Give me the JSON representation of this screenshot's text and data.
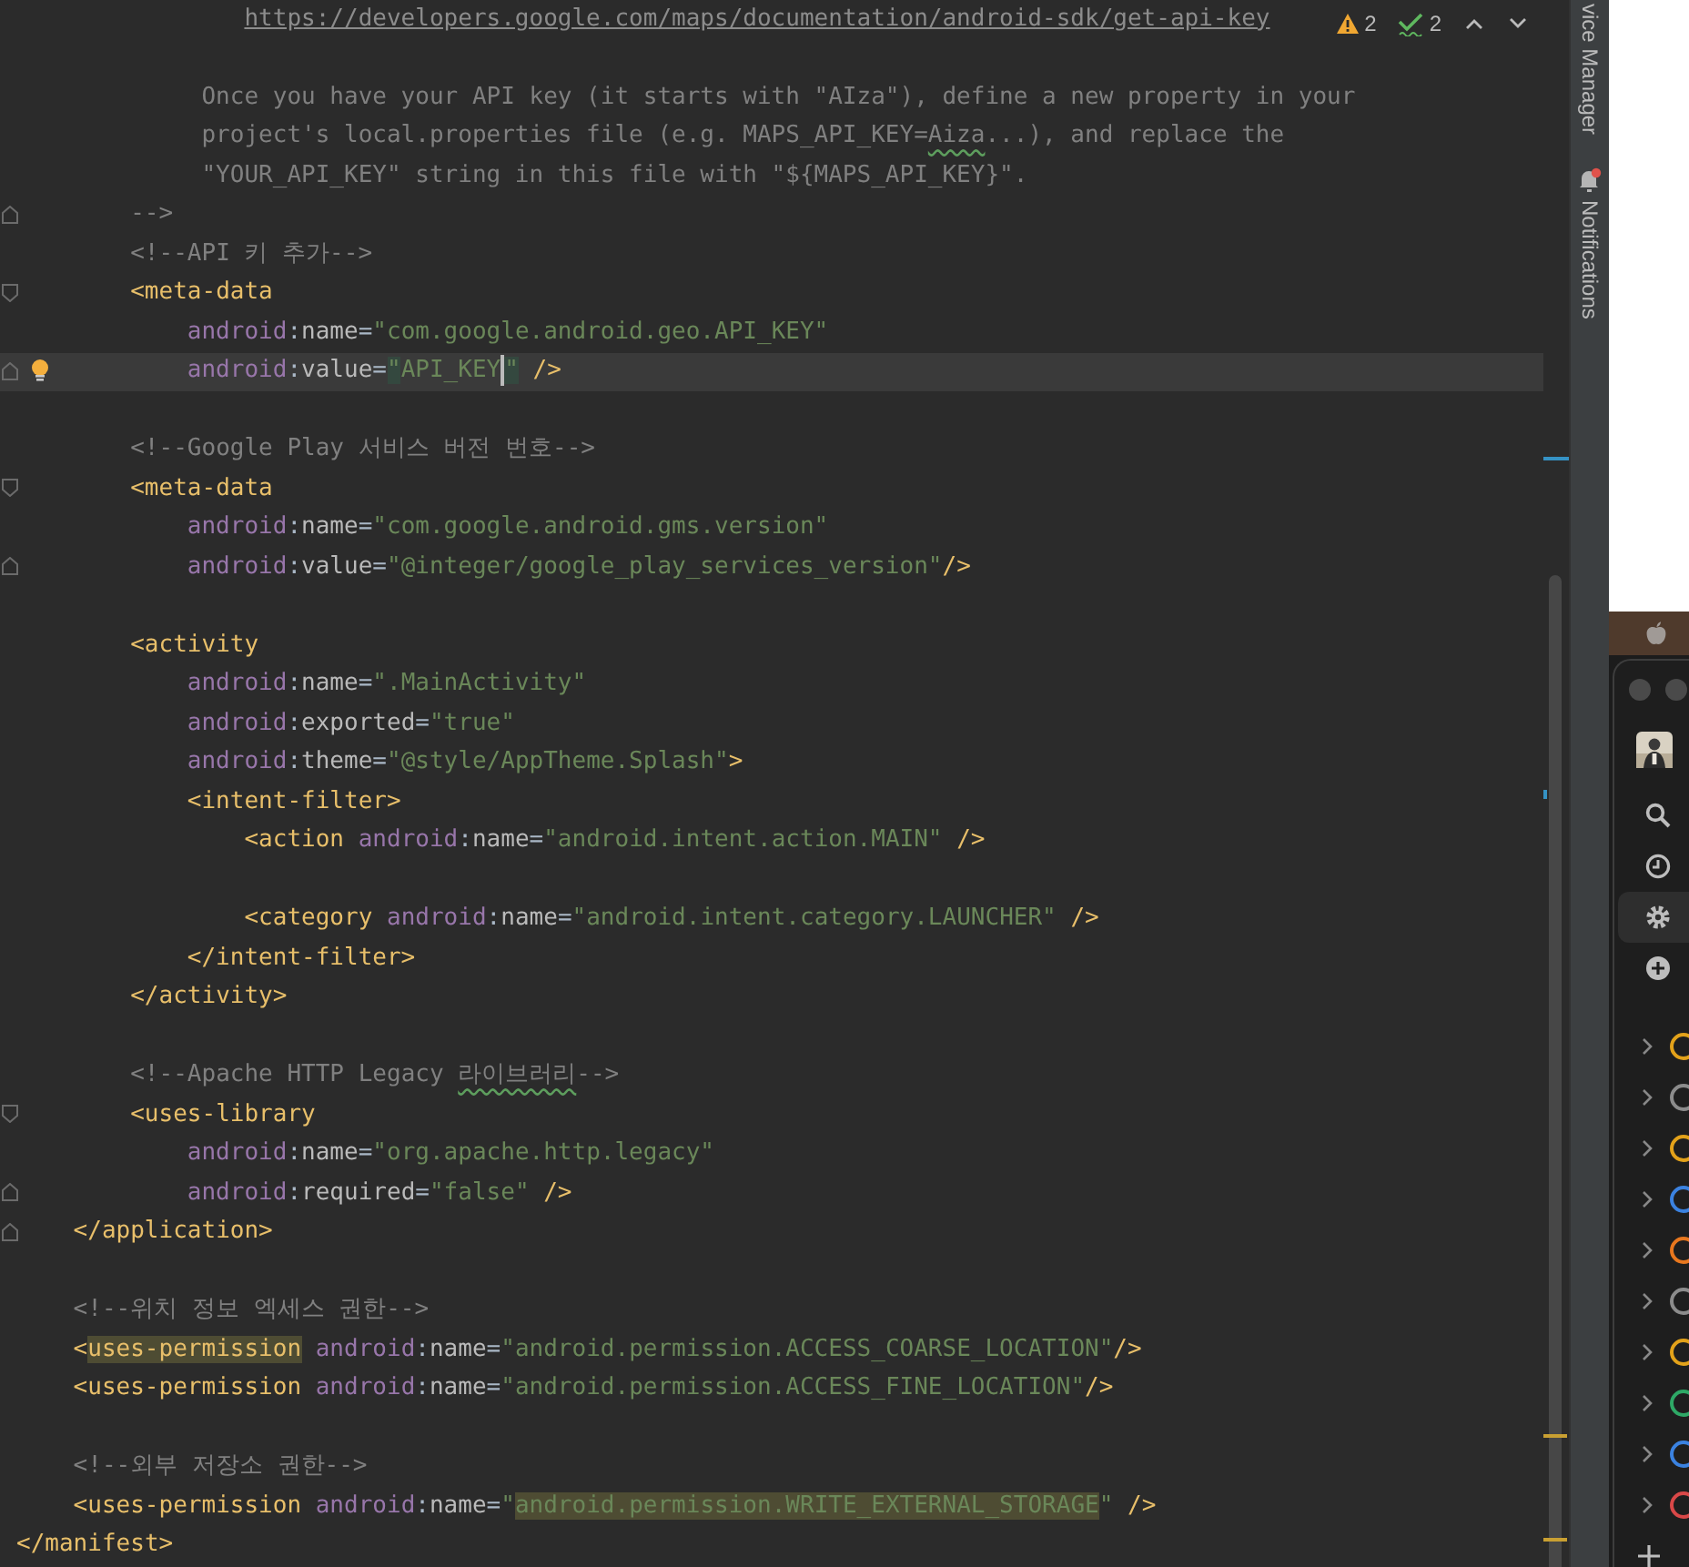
{
  "editor": {
    "lines": [
      {
        "kind": "code",
        "tokens": [
          {
            "kind": "link",
            "text": "                https://developers.google.com/maps/documentation/android-sdk/get-api-key"
          }
        ]
      },
      {
        "kind": "blank"
      },
      {
        "kind": "code",
        "tokens": [
          {
            "kind": "comment",
            "text": "             Once you have your API key (it starts with \"AIza\"), define a new property in your"
          }
        ]
      },
      {
        "kind": "code",
        "tokens": [
          {
            "kind": "comment",
            "text": "             project's local.properties file (e.g. MAPS_API_KEY="
          },
          {
            "kind": "comment",
            "text": "Aiza",
            "typo": true
          },
          {
            "kind": "comment",
            "text": "...), and replace the"
          }
        ]
      },
      {
        "kind": "code",
        "tokens": [
          {
            "kind": "comment",
            "text": "             \"YOUR_API_KEY\" string in this file with \"${MAPS_API_KEY}\"."
          }
        ]
      },
      {
        "kind": "code",
        "fold_end": true,
        "tokens": [
          {
            "kind": "comment",
            "text": "        -->"
          }
        ]
      },
      {
        "kind": "code",
        "tokens": [
          {
            "kind": "comment",
            "text": "        <!--API 키 추가-->"
          }
        ]
      },
      {
        "kind": "code",
        "fold_start": true,
        "tokens": [
          {
            "kind": "tag",
            "text": "        <meta-data"
          }
        ]
      },
      {
        "kind": "code",
        "tokens": [
          {
            "kind": "ns",
            "text": "            android"
          },
          {
            "kind": "punct",
            "text": ":"
          },
          {
            "kind": "attr",
            "text": "name"
          },
          {
            "kind": "punct",
            "text": "="
          },
          {
            "kind": "string",
            "text": "\"com.google.android.geo.API_KEY\""
          }
        ]
      },
      {
        "kind": "code",
        "fold_end": true,
        "current": true,
        "intention": true,
        "tokens": [
          {
            "kind": "ns",
            "text": "            android"
          },
          {
            "kind": "punct",
            "text": ":"
          },
          {
            "kind": "attr",
            "text": "value"
          },
          {
            "kind": "punct",
            "text": "="
          },
          {
            "kind": "string",
            "text": "\"",
            "brace_match": true
          },
          {
            "kind": "string",
            "text": "API_KEY",
            "caret": true
          },
          {
            "kind": "string",
            "text": "\"",
            "brace_match": true
          },
          {
            "kind": "tag",
            "text": " />"
          }
        ]
      },
      {
        "kind": "blank"
      },
      {
        "kind": "code",
        "tokens": [
          {
            "kind": "comment",
            "text": "        <!--Google Play 서비스 버전 번호-->"
          }
        ]
      },
      {
        "kind": "code",
        "fold_start": true,
        "tokens": [
          {
            "kind": "tag",
            "text": "        <meta-data"
          }
        ]
      },
      {
        "kind": "code",
        "tokens": [
          {
            "kind": "ns",
            "text": "            android"
          },
          {
            "kind": "punct",
            "text": ":"
          },
          {
            "kind": "attr",
            "text": "name"
          },
          {
            "kind": "punct",
            "text": "="
          },
          {
            "kind": "string",
            "text": "\"com.google.android.gms.version\""
          }
        ]
      },
      {
        "kind": "code",
        "fold_end": true,
        "tokens": [
          {
            "kind": "ns",
            "text": "            android"
          },
          {
            "kind": "punct",
            "text": ":"
          },
          {
            "kind": "attr",
            "text": "value"
          },
          {
            "kind": "punct",
            "text": "="
          },
          {
            "kind": "string",
            "text": "\"@integer/google_play_services_version\""
          },
          {
            "kind": "tag",
            "text": "/>"
          }
        ]
      },
      {
        "kind": "blank"
      },
      {
        "kind": "code",
        "tokens": [
          {
            "kind": "tag",
            "text": "        <activity"
          }
        ]
      },
      {
        "kind": "code",
        "tokens": [
          {
            "kind": "ns",
            "text": "            android"
          },
          {
            "kind": "punct",
            "text": ":"
          },
          {
            "kind": "attr",
            "text": "name"
          },
          {
            "kind": "punct",
            "text": "="
          },
          {
            "kind": "string",
            "text": "\".MainActivity\""
          }
        ]
      },
      {
        "kind": "code",
        "tokens": [
          {
            "kind": "ns",
            "text": "            android"
          },
          {
            "kind": "punct",
            "text": ":"
          },
          {
            "kind": "attr",
            "text": "exported"
          },
          {
            "kind": "punct",
            "text": "="
          },
          {
            "kind": "string",
            "text": "\"true\""
          }
        ]
      },
      {
        "kind": "code",
        "tokens": [
          {
            "kind": "ns",
            "text": "            android"
          },
          {
            "kind": "punct",
            "text": ":"
          },
          {
            "kind": "attr",
            "text": "theme"
          },
          {
            "kind": "punct",
            "text": "="
          },
          {
            "kind": "string",
            "text": "\"@style/AppTheme.Splash\""
          },
          {
            "kind": "tag",
            "text": ">"
          }
        ]
      },
      {
        "kind": "code",
        "tokens": [
          {
            "kind": "tag",
            "text": "            <intent-filter>"
          }
        ]
      },
      {
        "kind": "code",
        "tokens": [
          {
            "kind": "tag",
            "text": "                <action"
          },
          {
            "kind": "ns",
            "text": " android"
          },
          {
            "kind": "punct",
            "text": ":"
          },
          {
            "kind": "attr",
            "text": "name"
          },
          {
            "kind": "punct",
            "text": "="
          },
          {
            "kind": "string",
            "text": "\"android.intent.action.MAIN\""
          },
          {
            "kind": "tag",
            "text": " />"
          }
        ]
      },
      {
        "kind": "blank"
      },
      {
        "kind": "code",
        "tokens": [
          {
            "kind": "tag",
            "text": "                <category"
          },
          {
            "kind": "ns",
            "text": " android"
          },
          {
            "kind": "punct",
            "text": ":"
          },
          {
            "kind": "attr",
            "text": "name"
          },
          {
            "kind": "punct",
            "text": "="
          },
          {
            "kind": "string",
            "text": "\"android.intent.category.LAUNCHER\""
          },
          {
            "kind": "tag",
            "text": " />"
          }
        ]
      },
      {
        "kind": "code",
        "tokens": [
          {
            "kind": "tag",
            "text": "            </intent-filter>"
          }
        ]
      },
      {
        "kind": "code",
        "tokens": [
          {
            "kind": "tag",
            "text": "        </activity>"
          }
        ]
      },
      {
        "kind": "blank"
      },
      {
        "kind": "code",
        "tokens": [
          {
            "kind": "comment",
            "text": "        <!--Apache HTTP Legacy "
          },
          {
            "kind": "comment",
            "text": "라이브러리",
            "typo": true
          },
          {
            "kind": "comment",
            "text": "-->"
          }
        ]
      },
      {
        "kind": "code",
        "fold_start": true,
        "tokens": [
          {
            "kind": "tag",
            "text": "        <uses-library"
          }
        ]
      },
      {
        "kind": "code",
        "tokens": [
          {
            "kind": "ns",
            "text": "            android"
          },
          {
            "kind": "punct",
            "text": ":"
          },
          {
            "kind": "attr",
            "text": "name"
          },
          {
            "kind": "punct",
            "text": "="
          },
          {
            "kind": "string",
            "text": "\"org.apache.http.legacy\""
          }
        ]
      },
      {
        "kind": "code",
        "fold_end": true,
        "tokens": [
          {
            "kind": "ns",
            "text": "            android"
          },
          {
            "kind": "punct",
            "text": ":"
          },
          {
            "kind": "attr",
            "text": "required"
          },
          {
            "kind": "punct",
            "text": "="
          },
          {
            "kind": "string",
            "text": "\"false\""
          },
          {
            "kind": "tag",
            "text": " />"
          }
        ]
      },
      {
        "kind": "code",
        "fold_end": true,
        "tokens": [
          {
            "kind": "tag",
            "text": "    </application>"
          }
        ]
      },
      {
        "kind": "blank"
      },
      {
        "kind": "code",
        "tokens": [
          {
            "kind": "comment",
            "text": "    <!--위치 정보 엑세스 권한-->"
          }
        ]
      },
      {
        "kind": "code",
        "tokens": [
          {
            "kind": "tag",
            "text": "    <"
          },
          {
            "kind": "tag",
            "text": "uses-permission",
            "usage_highlight": true
          },
          {
            "kind": "ns",
            "text": " android"
          },
          {
            "kind": "punct",
            "text": ":"
          },
          {
            "kind": "attr",
            "text": "name"
          },
          {
            "kind": "punct",
            "text": "="
          },
          {
            "kind": "string",
            "text": "\"android.permission.ACCESS_COARSE_LOCATION\""
          },
          {
            "kind": "tag",
            "text": "/>"
          }
        ]
      },
      {
        "kind": "code",
        "tokens": [
          {
            "kind": "tag",
            "text": "    <uses-permission"
          },
          {
            "kind": "ns",
            "text": " android"
          },
          {
            "kind": "punct",
            "text": ":"
          },
          {
            "kind": "attr",
            "text": "name"
          },
          {
            "kind": "punct",
            "text": "="
          },
          {
            "kind": "string",
            "text": "\"android.permission.ACCESS_FINE_LOCATION\""
          },
          {
            "kind": "tag",
            "text": "/>"
          }
        ]
      },
      {
        "kind": "blank"
      },
      {
        "kind": "code",
        "tokens": [
          {
            "kind": "comment",
            "text": "    <!--외부 저장소 권한-->"
          }
        ]
      },
      {
        "kind": "code",
        "tokens": [
          {
            "kind": "tag",
            "text": "    <uses-permission"
          },
          {
            "kind": "ns",
            "text": " android"
          },
          {
            "kind": "punct",
            "text": ":"
          },
          {
            "kind": "attr",
            "text": "name"
          },
          {
            "kind": "punct",
            "text": "="
          },
          {
            "kind": "string",
            "text": "\""
          },
          {
            "kind": "string",
            "text": "android.permission.WRITE_EXTERNAL_STORAGE",
            "usage_highlight": true
          },
          {
            "kind": "string",
            "text": "\""
          },
          {
            "kind": "tag",
            "text": " />"
          }
        ]
      },
      {
        "kind": "code",
        "tokens": [
          {
            "kind": "tag",
            "text": "</manifest>"
          }
        ]
      }
    ],
    "inspections": [
      {
        "kind": "warning",
        "count": "2"
      },
      {
        "kind": "typo",
        "count": "2"
      }
    ]
  },
  "tool_windows": [
    {
      "label": "vice Manager",
      "alert": false
    },
    {
      "label": "Notifications",
      "alert": true
    }
  ],
  "side_app": {
    "menu": [
      {
        "kind": "search",
        "selected": false
      },
      {
        "kind": "recent",
        "selected": false
      },
      {
        "kind": "settings",
        "selected": true
      },
      {
        "kind": "add",
        "selected": false
      }
    ],
    "items": [
      {
        "color": "#e3a21a",
        "expanded": false
      },
      {
        "color": "#8c8c8c",
        "expanded": false
      },
      {
        "color": "#e3a21a",
        "expanded": false
      },
      {
        "color": "#3b82e0",
        "expanded": false
      },
      {
        "color": "#e8771e",
        "expanded": false
      },
      {
        "color": "#8c8c8c",
        "expanded": false
      },
      {
        "color": "#e3a21a",
        "expanded": false
      },
      {
        "color": "#2ea866",
        "expanded": false
      },
      {
        "color": "#3b82e0",
        "expanded": false
      },
      {
        "color": "#d94848",
        "expanded": false
      }
    ]
  }
}
